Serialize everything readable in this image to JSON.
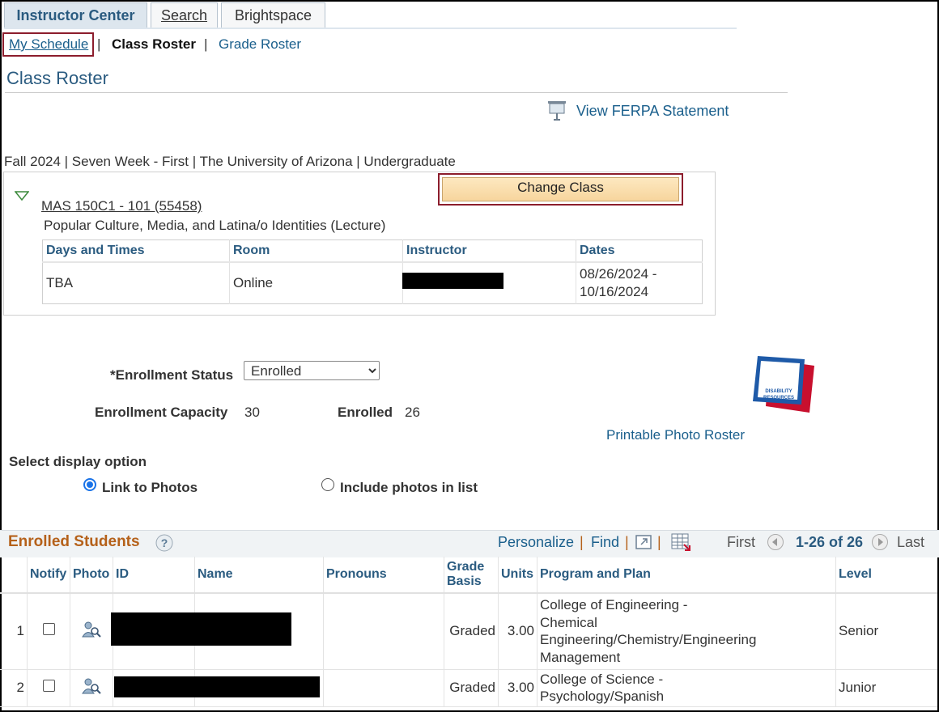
{
  "tabs": [
    {
      "label": "Instructor Center"
    },
    {
      "label": "Search"
    },
    {
      "label": "Brightspace"
    }
  ],
  "subnav": {
    "my_schedule": "My Schedule",
    "sep1": "|",
    "class_roster": "Class Roster",
    "sep2": "|",
    "grade_roster": "Grade Roster"
  },
  "page_title": "Class Roster",
  "ferpa_link": "View FERPA Statement",
  "term_info": "Fall 2024 | Seven Week - First | The University of Arizona | Undergraduate",
  "change_class_label": "Change Class",
  "class": {
    "code": "MAS 150C1 - 101 (55458)",
    "description": "Popular Culture, Media, and Latina/o Identities (Lecture)",
    "headers": [
      "Days and Times",
      "Room",
      "Instructor",
      "Dates"
    ],
    "days_times": "TBA",
    "room": "Online",
    "dates_start": "08/26/2024 -",
    "dates_end": "10/16/2024"
  },
  "enrollment": {
    "status_label": "*Enrollment Status",
    "status_value": "Enrolled",
    "capacity_label": "Enrollment Capacity",
    "capacity_value": "30",
    "enrolled_label": "Enrolled",
    "enrolled_value": "26"
  },
  "disability_logo_text": "DISABILITY RESOURCES",
  "printable_photo_roster": "Printable Photo Roster",
  "display_option": {
    "label": "Select display option",
    "option1": "Link to Photos",
    "option2": "Include photos in list",
    "selected": "Link to Photos"
  },
  "students_grid": {
    "title": "Enrolled Students",
    "personalize": "Personalize",
    "find": "Find",
    "first": "First",
    "range": "1-26 of 26",
    "last": "Last",
    "columns": [
      "Notify",
      "Photo",
      "ID",
      "Name",
      "Pronouns",
      "Grade Basis",
      "Units",
      "Program and Plan",
      "Level"
    ],
    "rows": [
      {
        "num": "1",
        "grade_basis": "Graded",
        "units": "3.00",
        "program": [
          "College of Engineering -",
          "Chemical",
          "Engineering/Chemistry/Engineering",
          "Management"
        ],
        "level": "Senior"
      },
      {
        "num": "2",
        "grade_basis": "Graded",
        "units": "3.00",
        "program": [
          "College of Science -",
          "Psychology/Spanish"
        ],
        "level": "Junior"
      }
    ]
  },
  "colors": {
    "link": "#1a5f8c",
    "header_blue": "#2a5b80",
    "grid_title": "#b5611a",
    "highlight_border": "#8c1d2c",
    "button_bg": "#f7d59d"
  }
}
